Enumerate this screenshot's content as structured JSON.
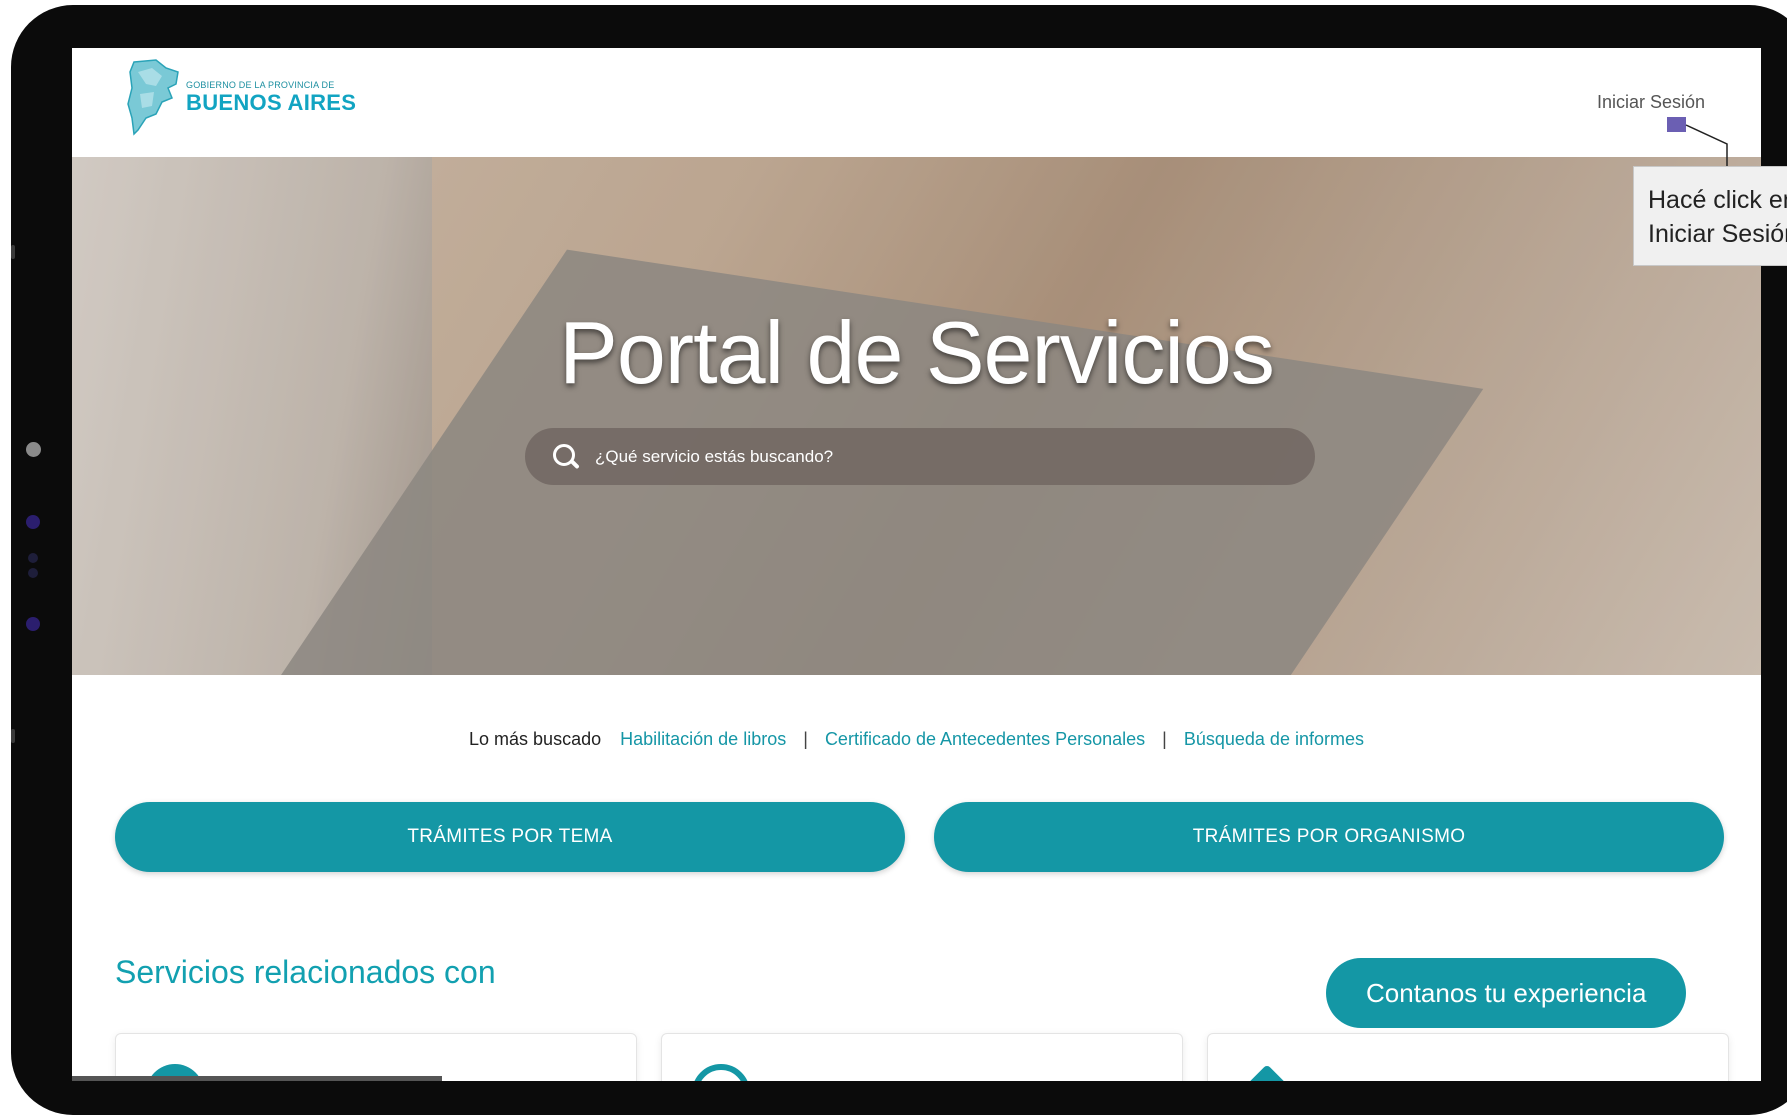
{
  "header": {
    "logo_small": "GOBIERNO DE LA PROVINCIA DE",
    "logo_big": "BUENOS AIRES",
    "login_label": "Iniciar Sesión"
  },
  "hero": {
    "title": "Portal de Servicios",
    "search_placeholder": "¿Qué servicio estás buscando?"
  },
  "popular": {
    "label": "Lo más buscado",
    "links": [
      "Habilitación de libros",
      "Certificado de Antecedentes Personales",
      "Búsqueda de informes"
    ],
    "separator": "|"
  },
  "buttons": {
    "tema": "TRÁMITES POR TEMA",
    "organismo": "TRÁMITES POR ORGANISMO"
  },
  "related": {
    "title": "Servicios relacionados con"
  },
  "feedback": {
    "label": "Contanos tu experiencia"
  },
  "tooltip": {
    "line1": "Hacé click en",
    "line2": "Iniciar Sesión"
  },
  "colors": {
    "accent": "#1497a5",
    "marker": "#6b5fb3"
  },
  "icons": [
    "search-icon",
    "logo-icon",
    "card-icon"
  ]
}
